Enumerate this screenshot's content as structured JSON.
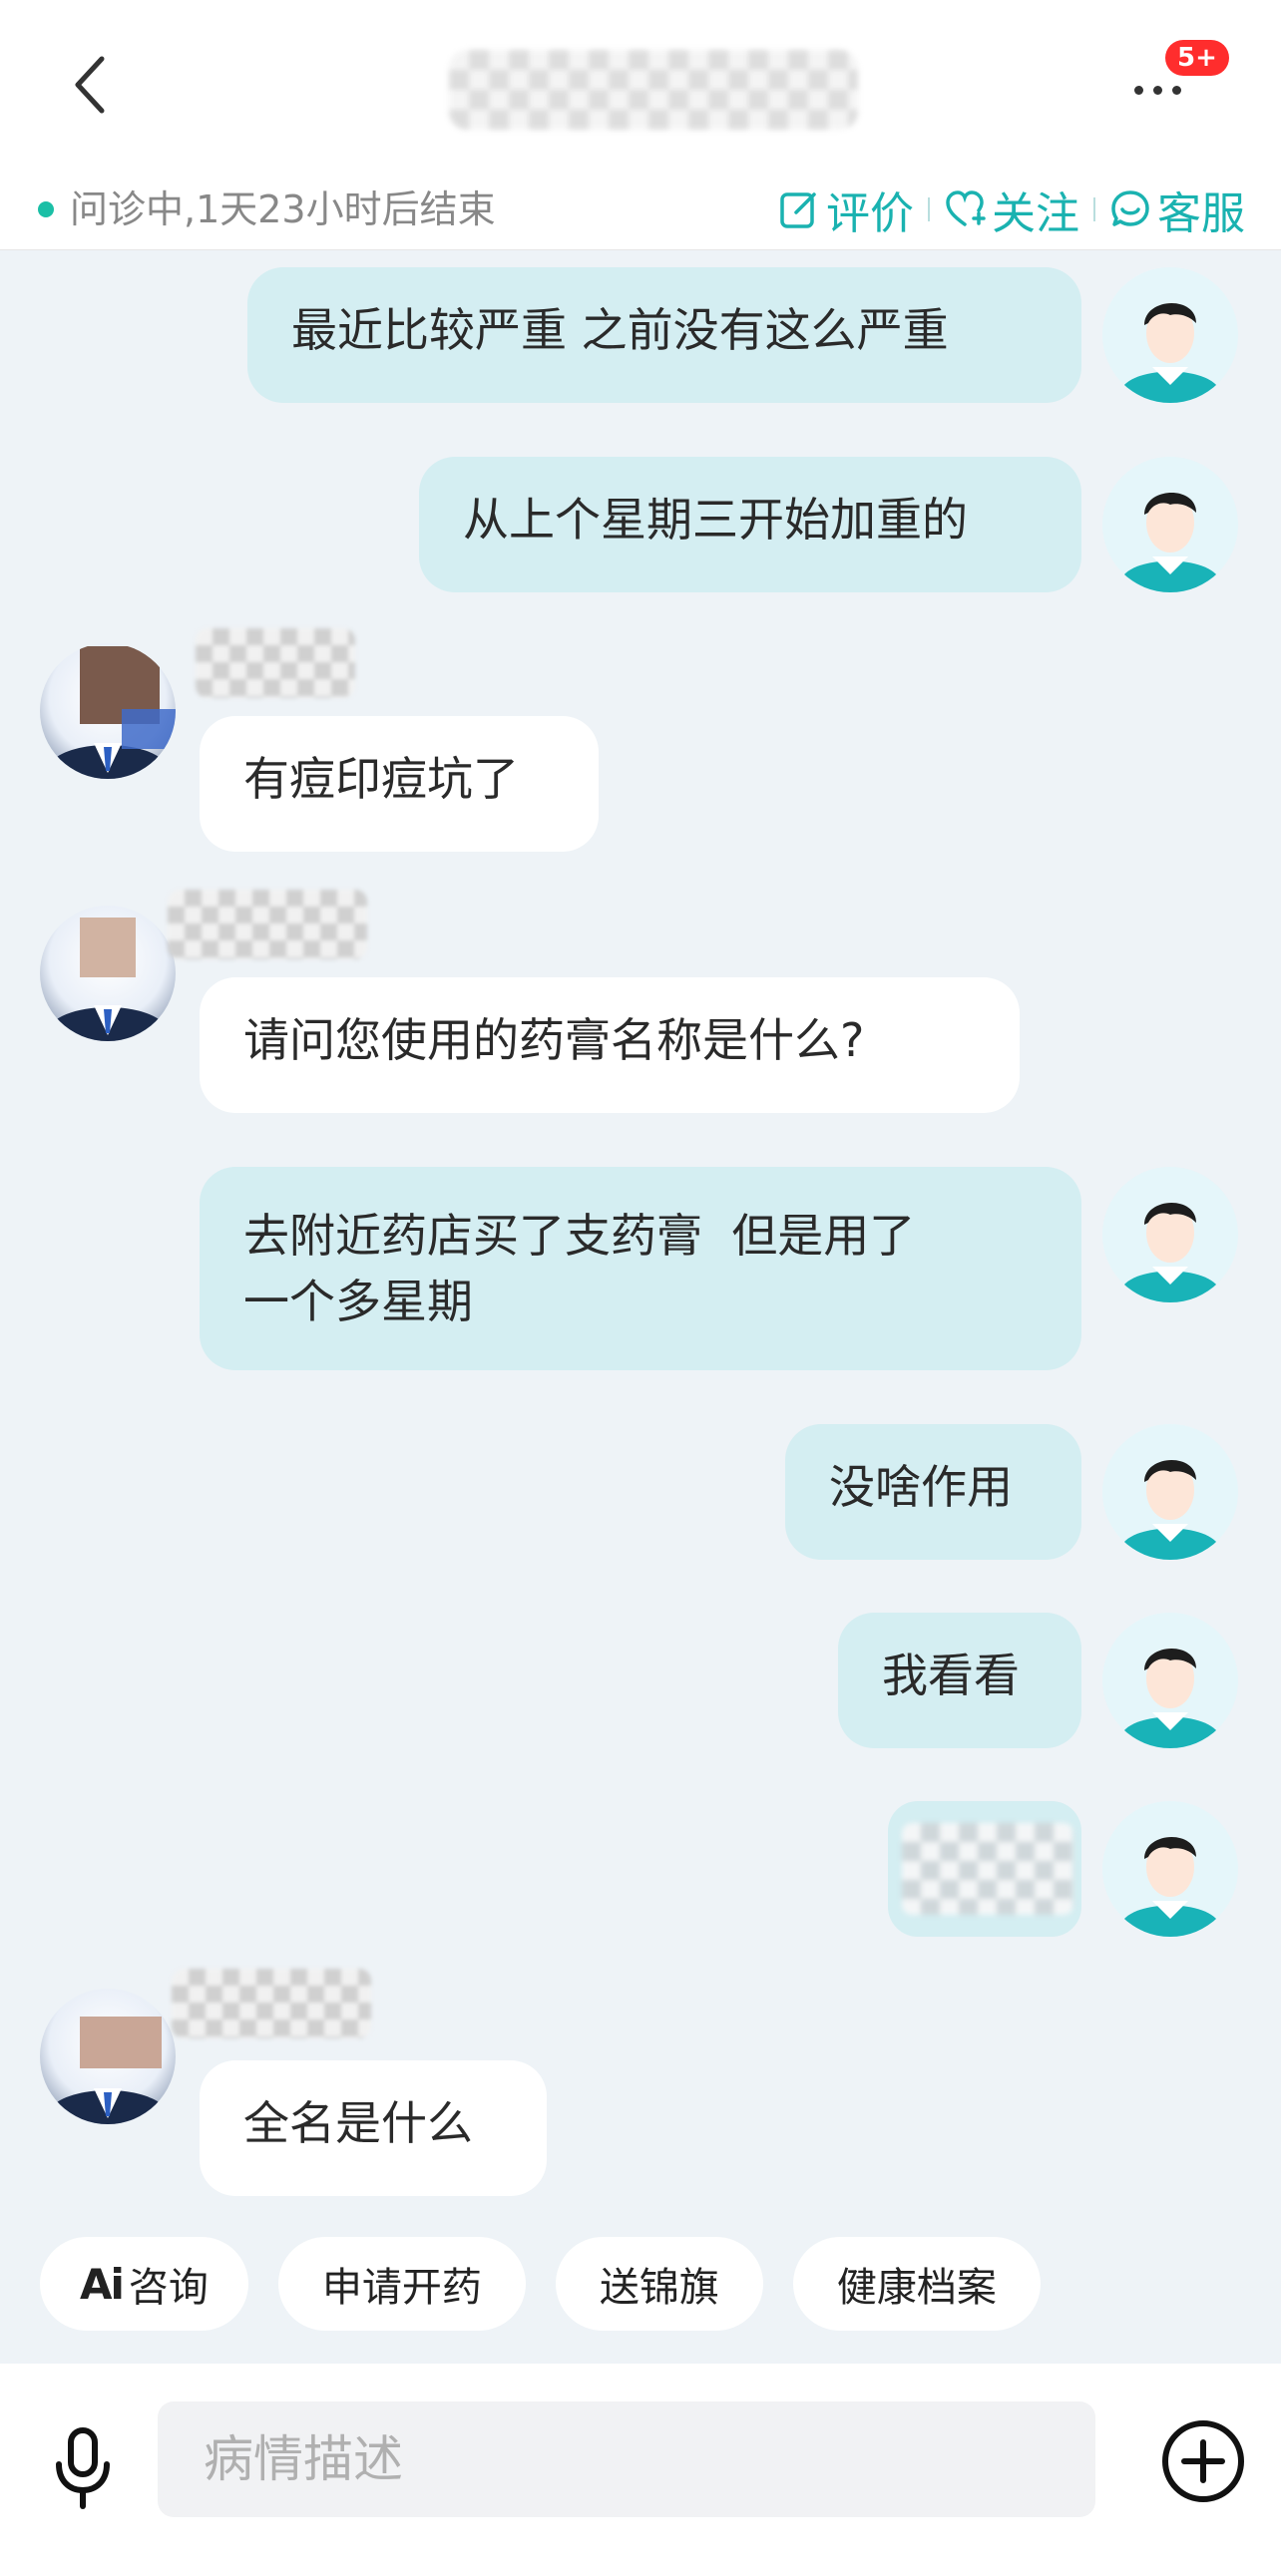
{
  "header": {
    "title": "",
    "badge": "5+"
  },
  "status": {
    "text": "问诊中,1天23小时后结束",
    "actions": {
      "review": "评价",
      "follow": "关注",
      "service": "客服"
    }
  },
  "messages": [
    {
      "sender": "user",
      "text": "最近比较严重 之前没有这么严重"
    },
    {
      "sender": "user",
      "text": "从上个星期三开始加重的"
    },
    {
      "sender": "doctor",
      "text": "有痘印痘坑了"
    },
    {
      "sender": "doctor",
      "text": "请问您使用的药膏名称是什么?"
    },
    {
      "sender": "user",
      "text": "去附近药店买了支药膏  但是用了\n一个多星期"
    },
    {
      "sender": "user",
      "text": "没啥作用"
    },
    {
      "sender": "user",
      "text": "我看看"
    },
    {
      "sender": "user",
      "text": ""
    },
    {
      "sender": "doctor",
      "text": "全名是什么"
    }
  ],
  "quick_actions": {
    "ai_label": "Ai",
    "consult": "咨询",
    "prescribe": "申请开药",
    "banner": "送锦旗",
    "health_record": "健康档案"
  },
  "composer": {
    "placeholder": "病情描述"
  },
  "icons": {
    "back": "chevron-left-icon",
    "more": "more-icon",
    "mic": "microphone-icon",
    "plus": "plus-circle-icon"
  },
  "colors": {
    "accent": "#1ab2b0",
    "user_bubble": "#d4eef2",
    "doctor_bubble": "#ffffff",
    "background": "#eef3f7",
    "badge": "#ff2d2d"
  }
}
